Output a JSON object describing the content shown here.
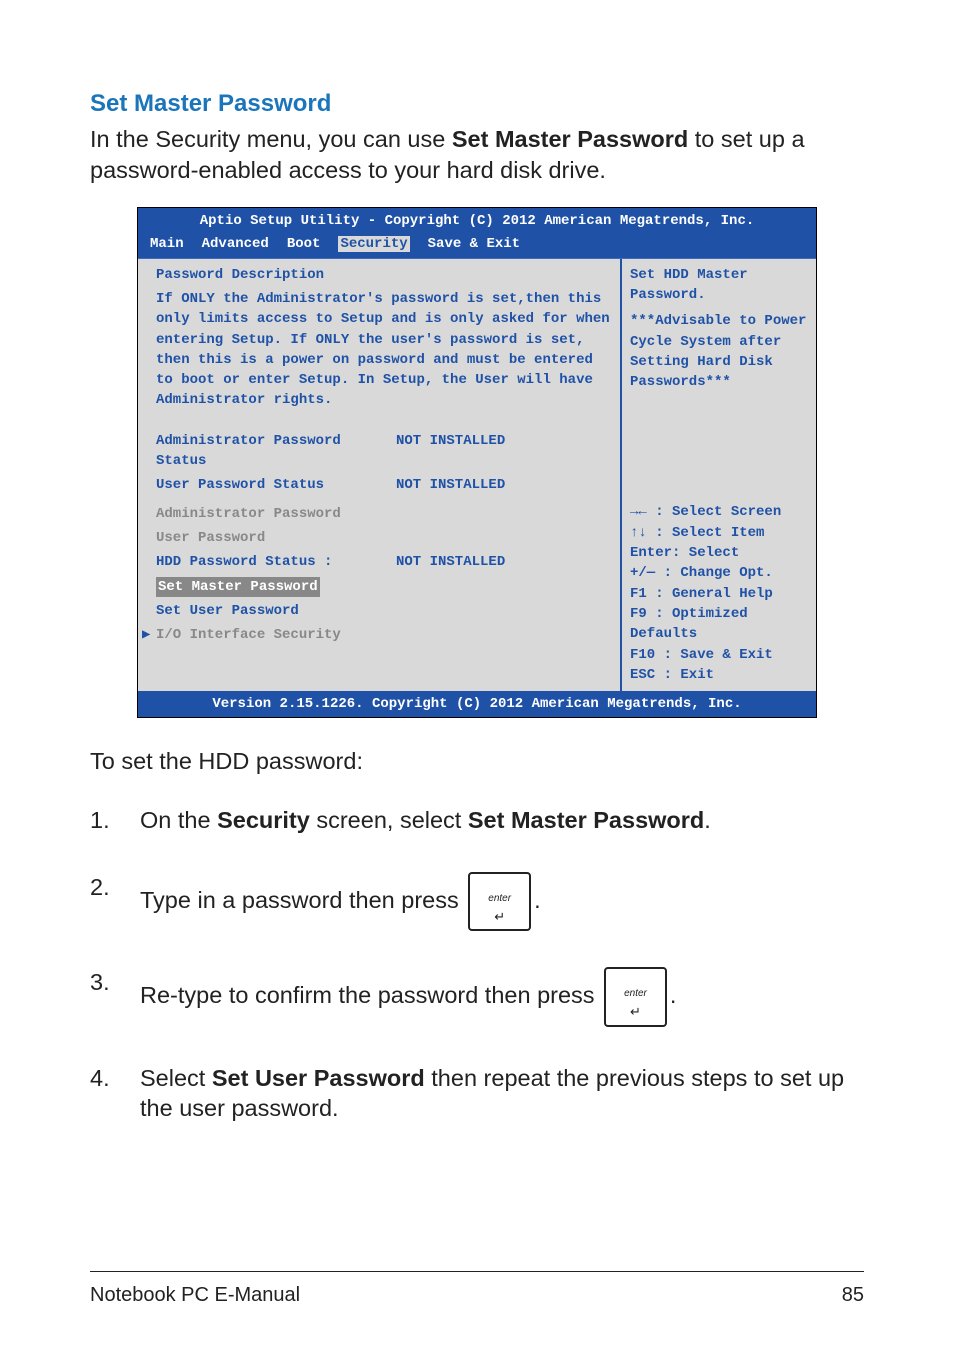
{
  "heading": "Set Master Password",
  "intro_prefix": "In the Security menu, you can use ",
  "intro_bold": "Set Master Password",
  "intro_suffix": " to set up a password-enabled access to your hard disk drive.",
  "bios": {
    "title": "Aptio Setup Utility - Copyright (C) 2012 American Megatrends, Inc.",
    "menu": {
      "main": "Main",
      "advanced": "Advanced",
      "boot": "Boot",
      "security": "Security",
      "save_exit": "Save & Exit"
    },
    "left": {
      "passdesc_heading": "Password Description",
      "passdesc_body": "If ONLY the Administrator's password is set,then this only limits access to Setup and is only asked for when entering Setup. If ONLY the user's password is set, then this is a power on password and must be entered to boot or enter Setup. In Setup, the User will have Administrator rights.",
      "admin_status_label": "Administrator Password Status",
      "admin_status_value": "NOT INSTALLED",
      "user_status_label": "User Password Status",
      "user_status_value": "NOT INSTALLED",
      "admin_password": "Administrator Password",
      "user_password": "User Password",
      "hdd_status_label": "HDD Password Status :",
      "hdd_status_value": "NOT INSTALLED",
      "set_master": "Set Master Password",
      "set_user": "Set User Password",
      "io_security": "I/O Interface Security"
    },
    "right": {
      "help1": "Set HDD Master Password.",
      "help2": "***Advisable to Power Cycle System after Setting Hard Disk Passwords***",
      "nav": [
        "→←  : Select Screen",
        "↑↓   : Select Item",
        "Enter: Select",
        "+/—  : Change Opt.",
        "F1   : General Help",
        "F9   : Optimized Defaults",
        "F10  : Save & Exit",
        "ESC  : Exit"
      ]
    },
    "footer": "Version 2.15.1226. Copyright (C) 2012 American Megatrends, Inc."
  },
  "steps_intro": "To set the HDD password:",
  "steps": {
    "s1_num": "1.",
    "s1_a": "On the ",
    "s1_b1": "Security",
    "s1_c": " screen, select ",
    "s1_b2": "Set Master Password",
    "s1_d": ".",
    "s2_num": "2.",
    "s2_a": "Type in a password then press ",
    "s2_b": ".",
    "s3_num": "3.",
    "s3_a": "Re-type to confirm the password then press ",
    "s3_b": ".",
    "s4_num": "4.",
    "s4_a": "Select ",
    "s4_b1": "Set User Password",
    "s4_c": " then repeat the previous steps to set up the user password."
  },
  "key_label": "enter",
  "footer": {
    "left": "Notebook PC E-Manual",
    "right": "85"
  }
}
